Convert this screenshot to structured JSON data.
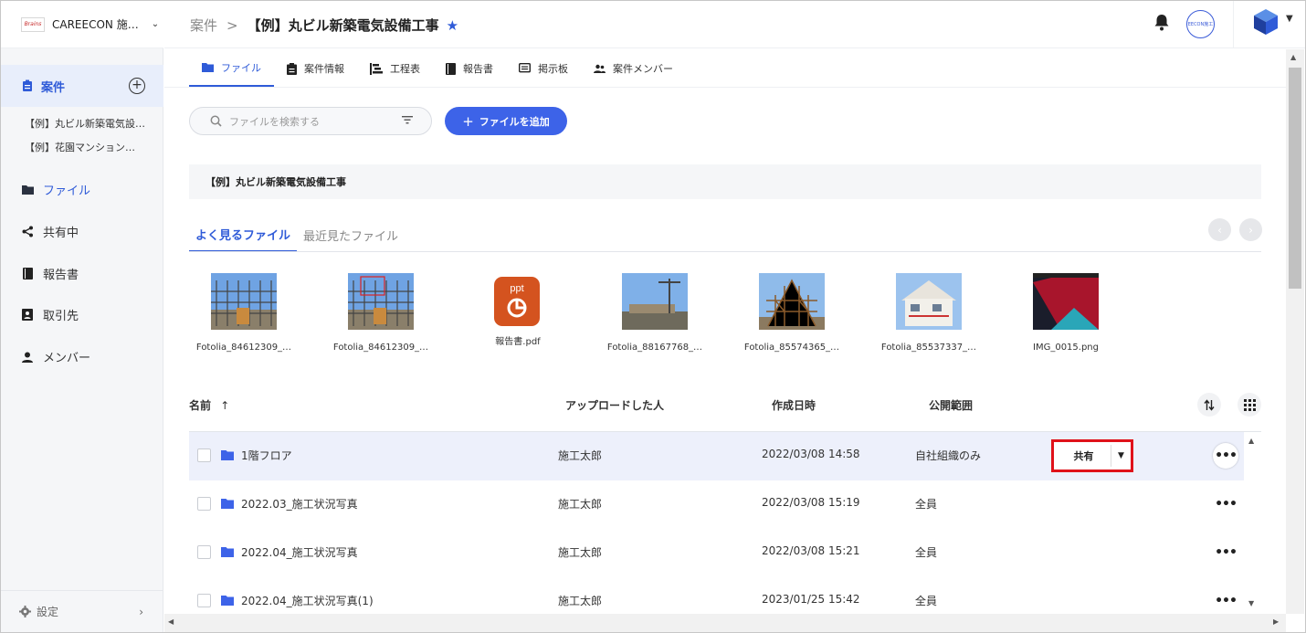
{
  "org": {
    "logo": "Brains",
    "name": "CAREECON 施…"
  },
  "sidebar": {
    "projects_label": "案件",
    "projects": [
      "【例】丸ビル新築電気設…",
      "【例】花園マンション…"
    ],
    "items": [
      {
        "label": "ファイル",
        "icon": "folder-icon"
      },
      {
        "label": "共有中",
        "icon": "share-icon"
      },
      {
        "label": "報告書",
        "icon": "book-icon"
      },
      {
        "label": "取引先",
        "icon": "contact-card-icon"
      },
      {
        "label": "メンバー",
        "icon": "person-icon"
      }
    ],
    "settings_label": "設定"
  },
  "header": {
    "crumb_parent": "案件",
    "crumb_separator": ">",
    "crumb_current": "【例】丸ビル新築電気設備工事",
    "avatar_text": "EECON施工"
  },
  "tabs": [
    {
      "label": "ファイル",
      "icon": "folder-icon"
    },
    {
      "label": "案件情報",
      "icon": "clipboard-icon"
    },
    {
      "label": "工程表",
      "icon": "gantt-icon"
    },
    {
      "label": "報告書",
      "icon": "book-icon"
    },
    {
      "label": "掲示板",
      "icon": "board-icon"
    },
    {
      "label": "案件メンバー",
      "icon": "people-icon"
    }
  ],
  "search": {
    "placeholder": "ファイルを検索する"
  },
  "add_button": {
    "label": "ファイルを追加"
  },
  "path": "【例】丸ビル新築電気設備工事",
  "file_tabs": [
    "よく見るファイル",
    "最近見たファイル"
  ],
  "recent_files": [
    {
      "name": "Fotolia_84612309_…"
    },
    {
      "name": "Fotolia_84612309_…"
    },
    {
      "name": "報告書.pdf",
      "badge": "ppt"
    },
    {
      "name": "Fotolia_88167768_…"
    },
    {
      "name": "Fotolia_85574365_…"
    },
    {
      "name": "Fotolia_85537337_…"
    },
    {
      "name": "IMG_0015.png"
    }
  ],
  "table": {
    "headers": {
      "name": "名前",
      "sort_indicator": "↑",
      "uploader": "アップロードした人",
      "created": "作成日時",
      "scope": "公開範囲"
    },
    "rows": [
      {
        "name": "1階フロア",
        "uploader": "施工太郎",
        "created": "2022/03/08 14:58",
        "scope": "自社組織のみ"
      },
      {
        "name": "2022.03_施工状況写真",
        "uploader": "施工太郎",
        "created": "2022/03/08 15:19",
        "scope": "全員"
      },
      {
        "name": "2022.04_施工状況写真",
        "uploader": "施工太郎",
        "created": "2022/03/08 15:21",
        "scope": "全員"
      },
      {
        "name": "2022.04_施工状況写真(1)",
        "uploader": "施工太郎",
        "created": "2023/01/25 15:42",
        "scope": "全員"
      }
    ],
    "share_button": "共有"
  },
  "colors": {
    "accent": "#3d63e8",
    "highlight_box": "#e0121a",
    "pdf_badge": "#d4531f"
  }
}
